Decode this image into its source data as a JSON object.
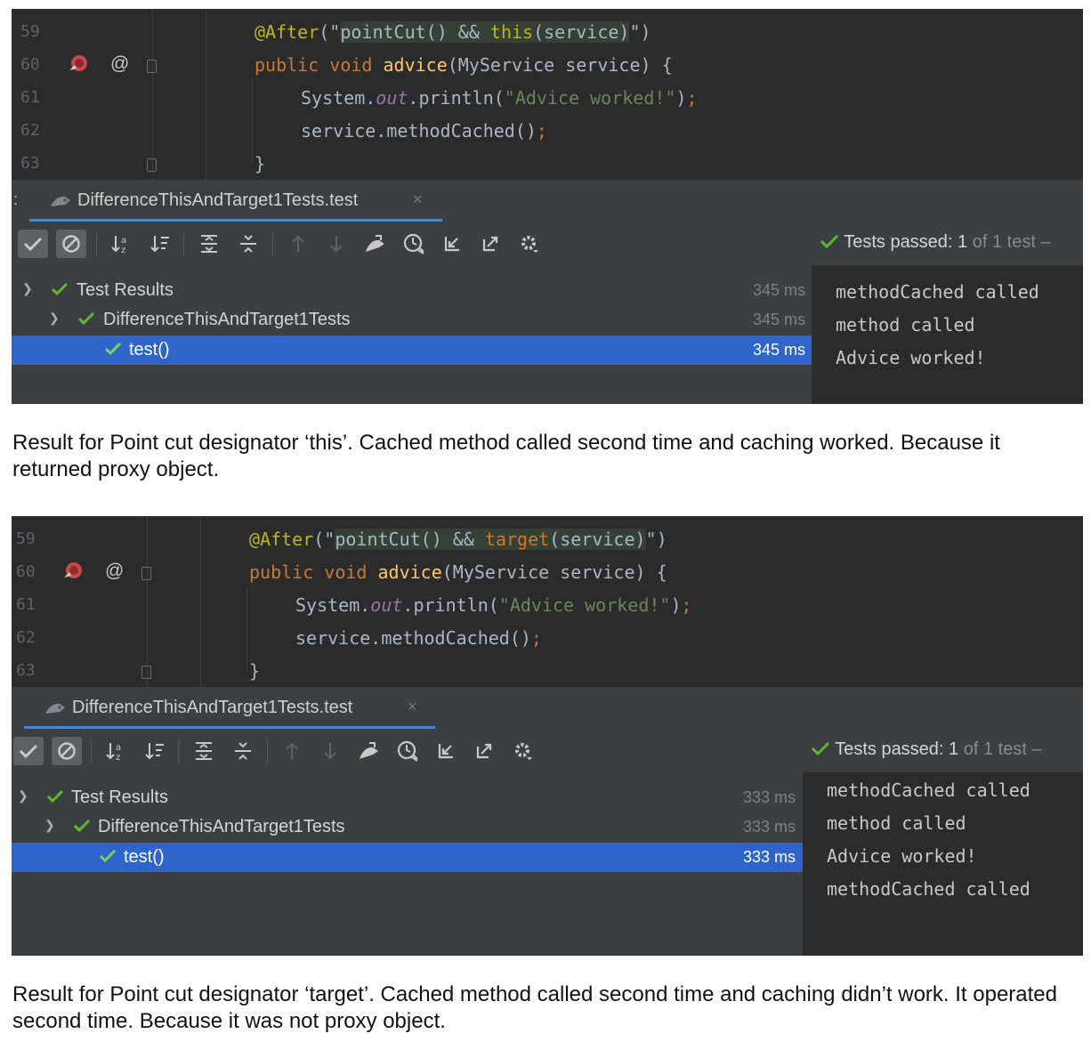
{
  "panels": [
    {
      "lines": [
        {
          "num": "59",
          "kind": "annotation",
          "a": "@After",
          "b": "(\"",
          "c": "pointCut() && ",
          "d": "this",
          "e": "(service)",
          "f": "\")"
        },
        {
          "num": "60",
          "kind": "signature",
          "a": "public",
          "b": " void ",
          "c": "advice",
          "d": "(MyService service) {"
        },
        {
          "num": "61",
          "kind": "print",
          "a": "System.",
          "b": "out",
          "c": ".println(",
          "d": "\"Advice worked!\"",
          "e": ")",
          "f": ";"
        },
        {
          "num": "62",
          "kind": "call",
          "a": "service.methodCached()",
          "b": ";"
        },
        {
          "num": "63",
          "kind": "brace",
          "a": "}"
        }
      ],
      "tab": {
        "label": "DifferenceThisAndTarget1Tests.test",
        "close": "×"
      },
      "status": {
        "prefix": "Tests passed: ",
        "count": "1",
        "suffix": " of 1 test –"
      },
      "tree": [
        {
          "label": "Test Results",
          "time": "345 ms"
        },
        {
          "label": "DifferenceThisAndTarget1Tests",
          "time": "345 ms"
        },
        {
          "label": "test()",
          "time": "345 ms"
        }
      ],
      "console": [
        "methodCached called",
        "method called",
        "Advice worked!"
      ]
    },
    {
      "lines": [
        {
          "num": "59",
          "kind": "annotation",
          "a": "@After",
          "b": "(\"",
          "c": "pointCut() && ",
          "d": "target",
          "e": "(service)",
          "f": "\")"
        },
        {
          "num": "60",
          "kind": "signature",
          "a": "public",
          "b": " void ",
          "c": "advice",
          "d": "(MyService service) {"
        },
        {
          "num": "61",
          "kind": "print",
          "a": "System.",
          "b": "out",
          "c": ".println(",
          "d": "\"Advice worked!\"",
          "e": ")",
          "f": ";"
        },
        {
          "num": "62",
          "kind": "call",
          "a": "service.methodCached()",
          "b": ";"
        },
        {
          "num": "63",
          "kind": "brace",
          "a": "}"
        }
      ],
      "tab": {
        "label": "DifferenceThisAndTarget1Tests.test",
        "close": "×"
      },
      "status": {
        "prefix": "Tests passed: ",
        "count": "1",
        "suffix": " of 1 test –"
      },
      "tree": [
        {
          "label": "Test Results",
          "time": "333 ms"
        },
        {
          "label": "DifferenceThisAndTarget1Tests",
          "time": "333 ms"
        },
        {
          "label": "test()",
          "time": "333 ms"
        }
      ],
      "console": [
        "methodCached called",
        "method called",
        "Advice worked!",
        "methodCached called"
      ]
    }
  ],
  "captions": [
    "Result for Point cut designator ‘this’. Cached method called second time and caching worked. Because it returned proxy object.",
    "Result for Point cut designator ‘target’. Cached method called second time and caching didn’t work. It operated second time. Because it was not proxy object."
  ],
  "icons": {
    "check": "check-icon",
    "stop": "stop-icon",
    "sort-alpha": "sort-alpha-icon",
    "sort-duration": "sort-duration-icon",
    "expand": "expand-all-icon",
    "collapse": "collapse-all-icon",
    "up": "arrow-up-icon",
    "down": "arrow-down-icon",
    "rerun": "rerun-icon",
    "history": "history-icon",
    "import": "import-icon",
    "export": "export-icon",
    "settings": "gear-icon"
  },
  "colors": {
    "keyword": "#cc7832",
    "annotation": "#bbb529",
    "string": "#6a8759",
    "function": "#ffc66d",
    "field": "#9876aa",
    "selection": "#2f65ca",
    "pass": "#5fb832"
  }
}
